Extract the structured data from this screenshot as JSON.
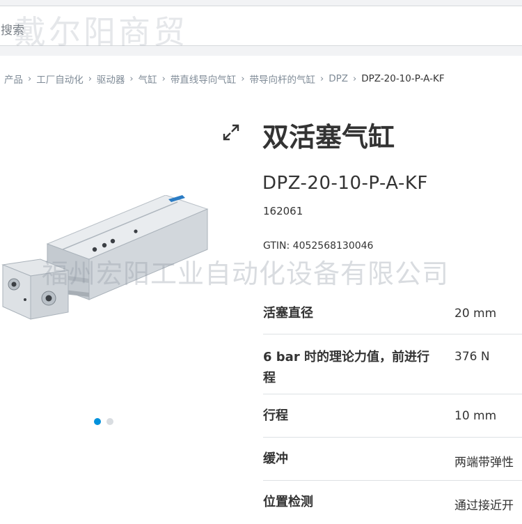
{
  "search": {
    "placeholder": "搜索"
  },
  "watermarks": {
    "top": "戴尔阳商贸",
    "middle": "福州宏阳工业自动化设备有限公司"
  },
  "breadcrumb": [
    "产品",
    "工厂自动化",
    "驱动器",
    "气缸",
    "带直线导向气缸",
    "带导向杆的气缸",
    "DPZ",
    "DPZ-20-10-P-A-KF"
  ],
  "product": {
    "title": "双活塞气缸",
    "part_number": "DPZ-20-10-P-A-KF",
    "order_code": "162061",
    "gtin": "GTIN: 4052568130046"
  },
  "gallery": {
    "image_count": 2,
    "active_index": 0
  },
  "specs": [
    {
      "label": "活塞直径",
      "value": "20 mm"
    },
    {
      "label": "6 bar 时的理论力值，前进行程",
      "value": "376 N"
    },
    {
      "label": "行程",
      "value": "10 mm"
    },
    {
      "label": "缓冲",
      "value": "两端带弹性"
    },
    {
      "label": "位置检测",
      "value": "通过接近开"
    }
  ],
  "colors": {
    "accent": "#0091dc",
    "text": "#333333",
    "muted": "#7f8b97",
    "topbar": "#f2f3f5"
  }
}
